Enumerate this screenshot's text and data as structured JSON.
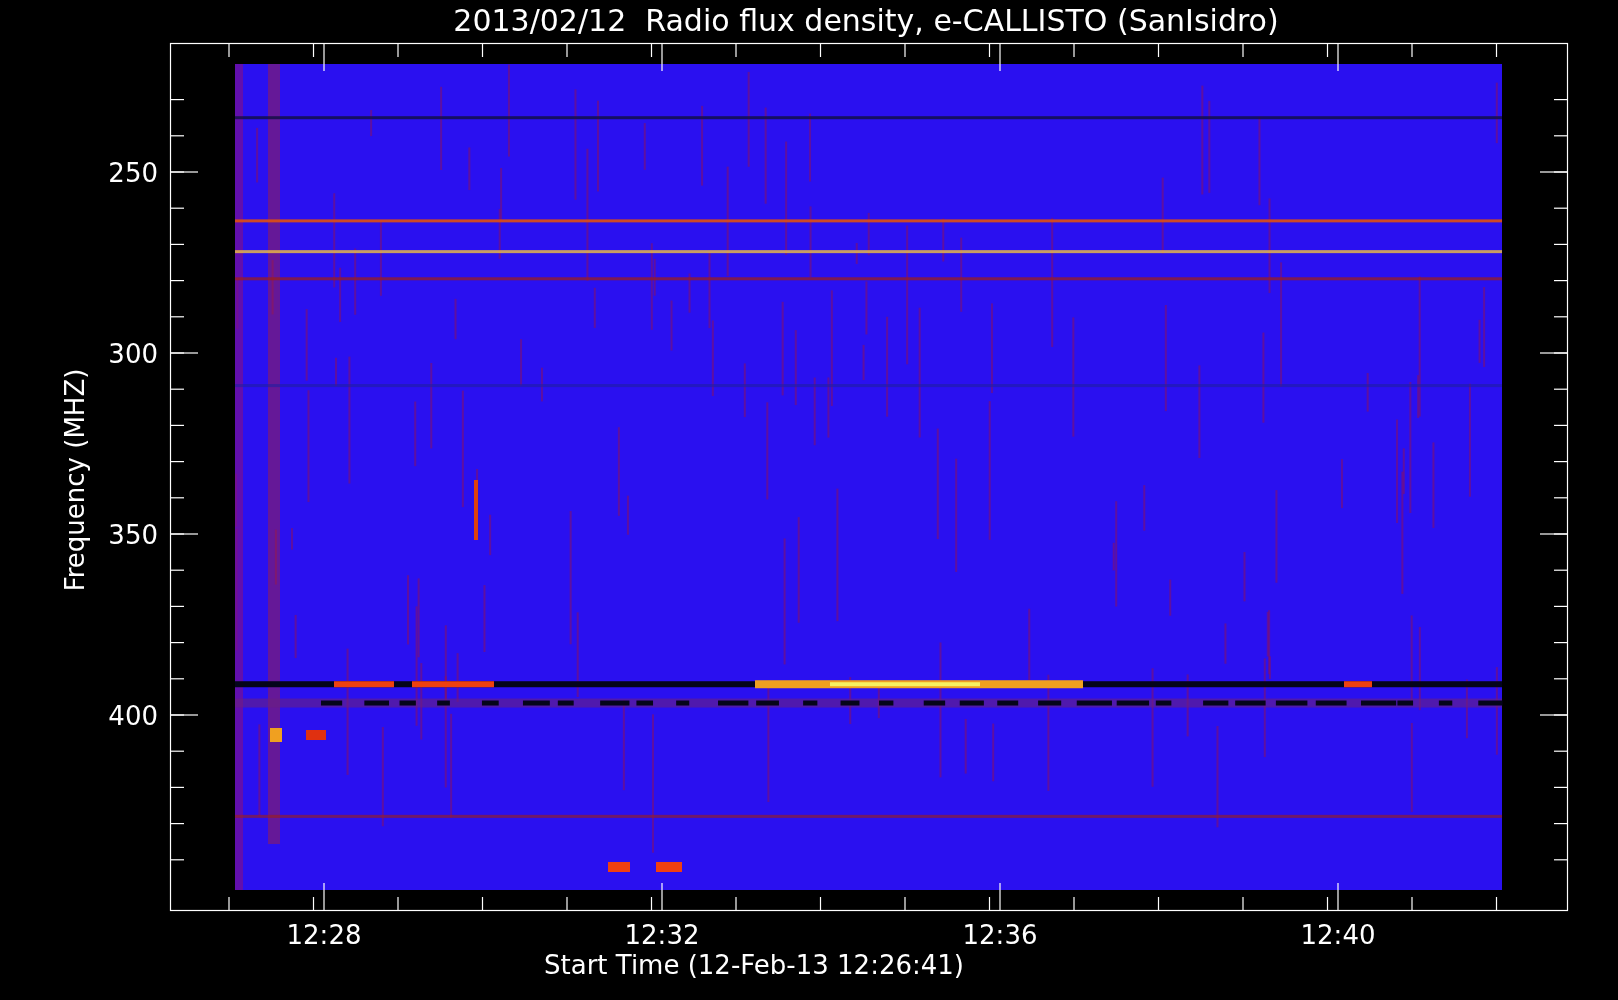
{
  "title": "2013/02/12  Radio flux density, e-CALLISTO (SanIsidro)",
  "y_axis": {
    "label": "Frequency (MHZ)",
    "ticks": [
      "250",
      "300",
      "350",
      "400"
    ]
  },
  "x_axis": {
    "label": "Start Time (12-Feb-13 12:26:41)",
    "ticks": [
      "12:28",
      "12:32",
      "12:36",
      "12:40"
    ]
  }
}
